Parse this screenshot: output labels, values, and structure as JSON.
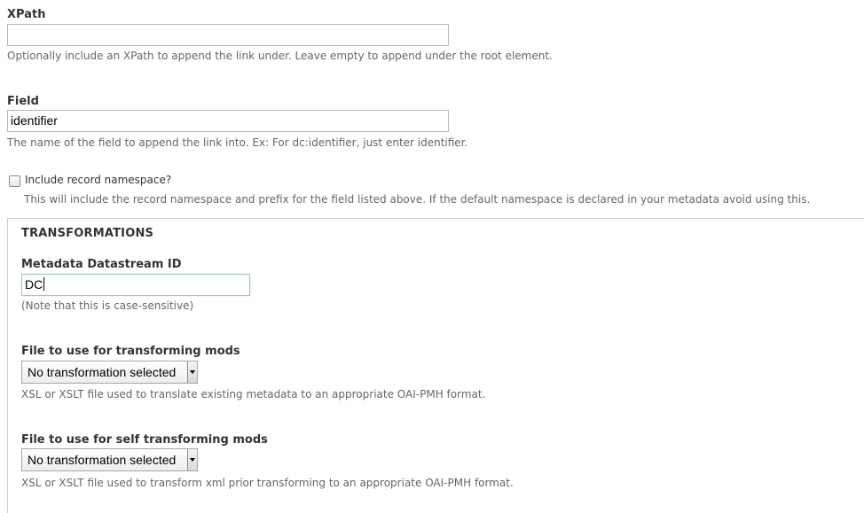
{
  "xpath": {
    "label": "XPath",
    "value": "",
    "description": "Optionally include an XPath to append the link under. Leave empty to append under the root element."
  },
  "field": {
    "label": "Field",
    "value": "identifier",
    "description": "The name of the field to append the link into. Ex: For dc:identifier, just enter identifier."
  },
  "include_namespace": {
    "label": "Include record namespace?",
    "checked": false,
    "description": "This will include the record namespace and prefix for the field listed above. If the default namespace is declared in your metadata avoid using this."
  },
  "transformations": {
    "legend": "TRANSFORMATIONS",
    "datastream_id": {
      "label": "Metadata Datastream ID",
      "value": "DC",
      "description": "(Note that this is case-sensitive)"
    },
    "transform_mods": {
      "label": "File to use for transforming mods",
      "selected": "No transformation selected",
      "description": "XSL or XSLT file used to translate existing metadata to an appropriate OAI-PMH format."
    },
    "self_transform_mods": {
      "label": "File to use for self transforming mods",
      "selected": "No transformation selected",
      "description": "XSL or XSLT file used to transform xml prior transforming to an appropriate OAI-PMH format."
    }
  },
  "icons": {
    "select_arrow": "triangle-down-icon",
    "checkbox": "checkbox-unchecked-icon"
  }
}
